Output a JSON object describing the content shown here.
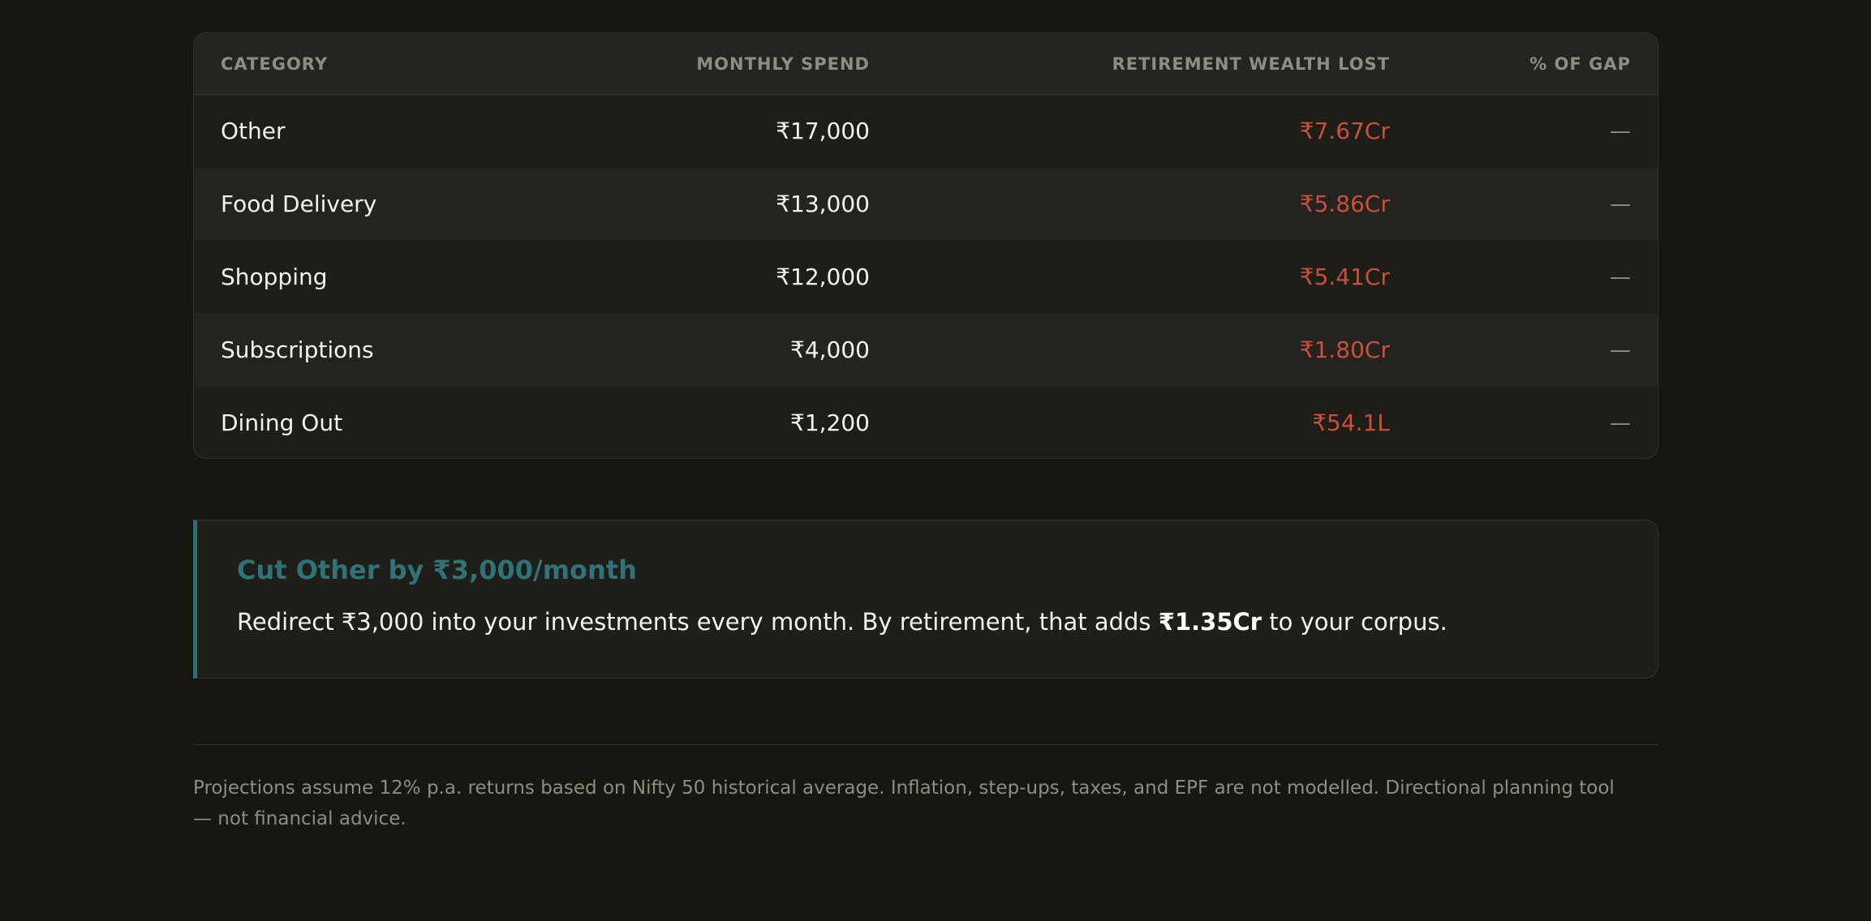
{
  "table": {
    "headers": {
      "category": "CATEGORY",
      "monthly_spend": "MONTHLY SPEND",
      "wealth_lost": "RETIREMENT WEALTH LOST",
      "gap_pct": "% OF GAP"
    },
    "rows": [
      {
        "category": "Other",
        "monthly_spend": "₹17,000",
        "wealth_lost": "₹7.67Cr",
        "gap_pct": "—"
      },
      {
        "category": "Food Delivery",
        "monthly_spend": "₹13,000",
        "wealth_lost": "₹5.86Cr",
        "gap_pct": "—"
      },
      {
        "category": "Shopping",
        "monthly_spend": "₹12,000",
        "wealth_lost": "₹5.41Cr",
        "gap_pct": "—"
      },
      {
        "category": "Subscriptions",
        "monthly_spend": "₹4,000",
        "wealth_lost": "₹1.80Cr",
        "gap_pct": "—"
      },
      {
        "category": "Dining Out",
        "monthly_spend": "₹1,200",
        "wealth_lost": "₹54.1L",
        "gap_pct": "—"
      }
    ]
  },
  "tip": {
    "title": "Cut Other by ₹3,000/month",
    "body_prefix": "Redirect ₹3,000 into your investments every month. By retirement, that adds ",
    "body_highlight": "₹1.35Cr",
    "body_suffix": " to your corpus."
  },
  "disclaimer": "Projections assume 12% p.a. returns based on Nifty 50 historical average. Inflation, step-ups, taxes, and EPF are not modelled. Directional planning tool — not financial advice.",
  "colors": {
    "background": "#171611",
    "loss_red": "#c9503a",
    "accent_teal": "#2f7378"
  }
}
